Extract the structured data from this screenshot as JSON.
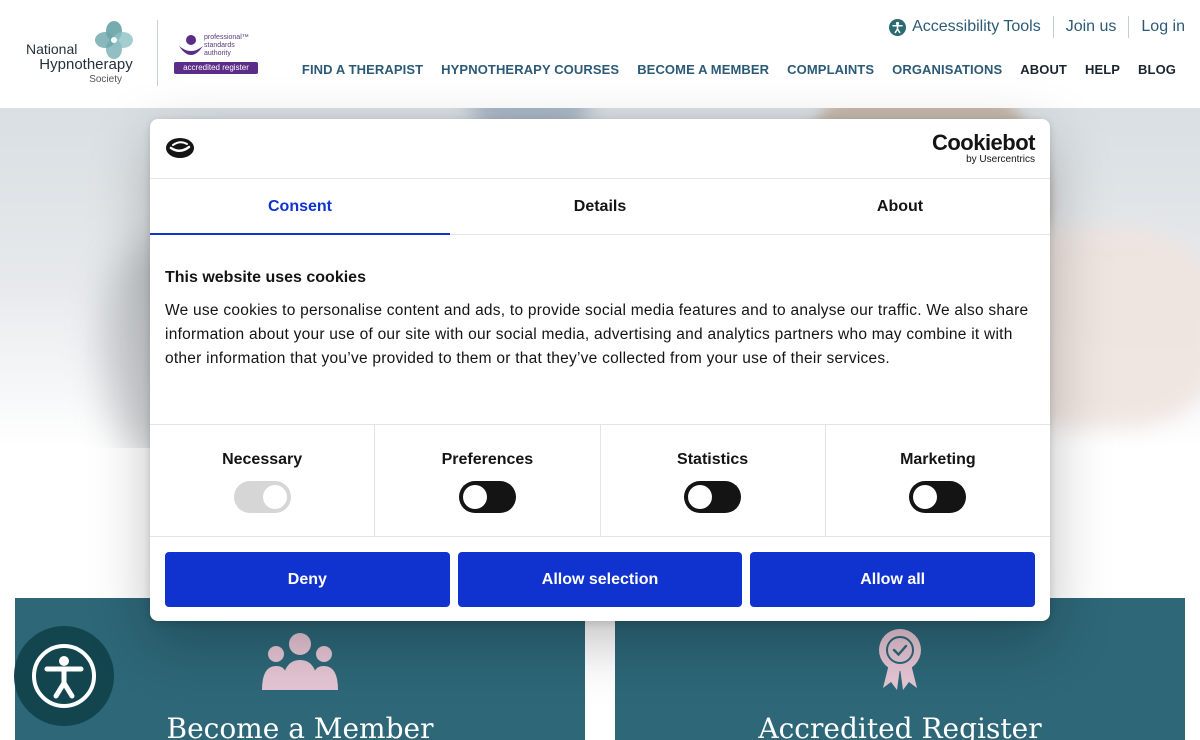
{
  "site": {
    "logo": {
      "line1": "National",
      "line2": "Hypnotherapy",
      "line3": "Society"
    },
    "psa": {
      "text_lines": [
        "professional™",
        "standards",
        "authority"
      ],
      "badge": "accredited register"
    },
    "toplinks": {
      "accessibility": "Accessibility Tools",
      "join": "Join us",
      "login": "Log in"
    },
    "nav": [
      "FIND A THERAPIST",
      "HYPNOTHERAPY COURSES",
      "BECOME A MEMBER",
      "COMPLAINTS",
      "ORGANISATIONS",
      "ABOUT",
      "HELP",
      "BLOG"
    ],
    "cards": [
      {
        "title": "Become a Member",
        "icon": "people-group-icon"
      },
      {
        "title": "Accredited Register",
        "icon": "award-rosette-icon"
      }
    ],
    "colors": {
      "nav_blue": "#2c5a76",
      "card_teal": "#2d6778",
      "psa_purple": "#5b2d86"
    }
  },
  "cookie_dialog": {
    "brand": {
      "name": "Cookiebot",
      "sub": "by Usercentrics"
    },
    "tabs": [
      "Consent",
      "Details",
      "About"
    ],
    "active_tab": "Consent",
    "title": "This website uses cookies",
    "text": "We use cookies to personalise content and ads, to provide social media features and to analyse our traffic. We also share information about your use of our site with our social media, advertising and analytics partners who may combine it with other information that you’ve provided to them or that they’ve collected from your use of their services.",
    "toggles": [
      {
        "label": "Necessary",
        "state": "on",
        "disabled": true
      },
      {
        "label": "Preferences",
        "state": "off"
      },
      {
        "label": "Statistics",
        "state": "off"
      },
      {
        "label": "Marketing",
        "state": "off"
      }
    ],
    "buttons": {
      "deny": "Deny",
      "allow_selection": "Allow selection",
      "allow_all": "Allow all"
    },
    "colors": {
      "primary": "#1032cf"
    }
  }
}
